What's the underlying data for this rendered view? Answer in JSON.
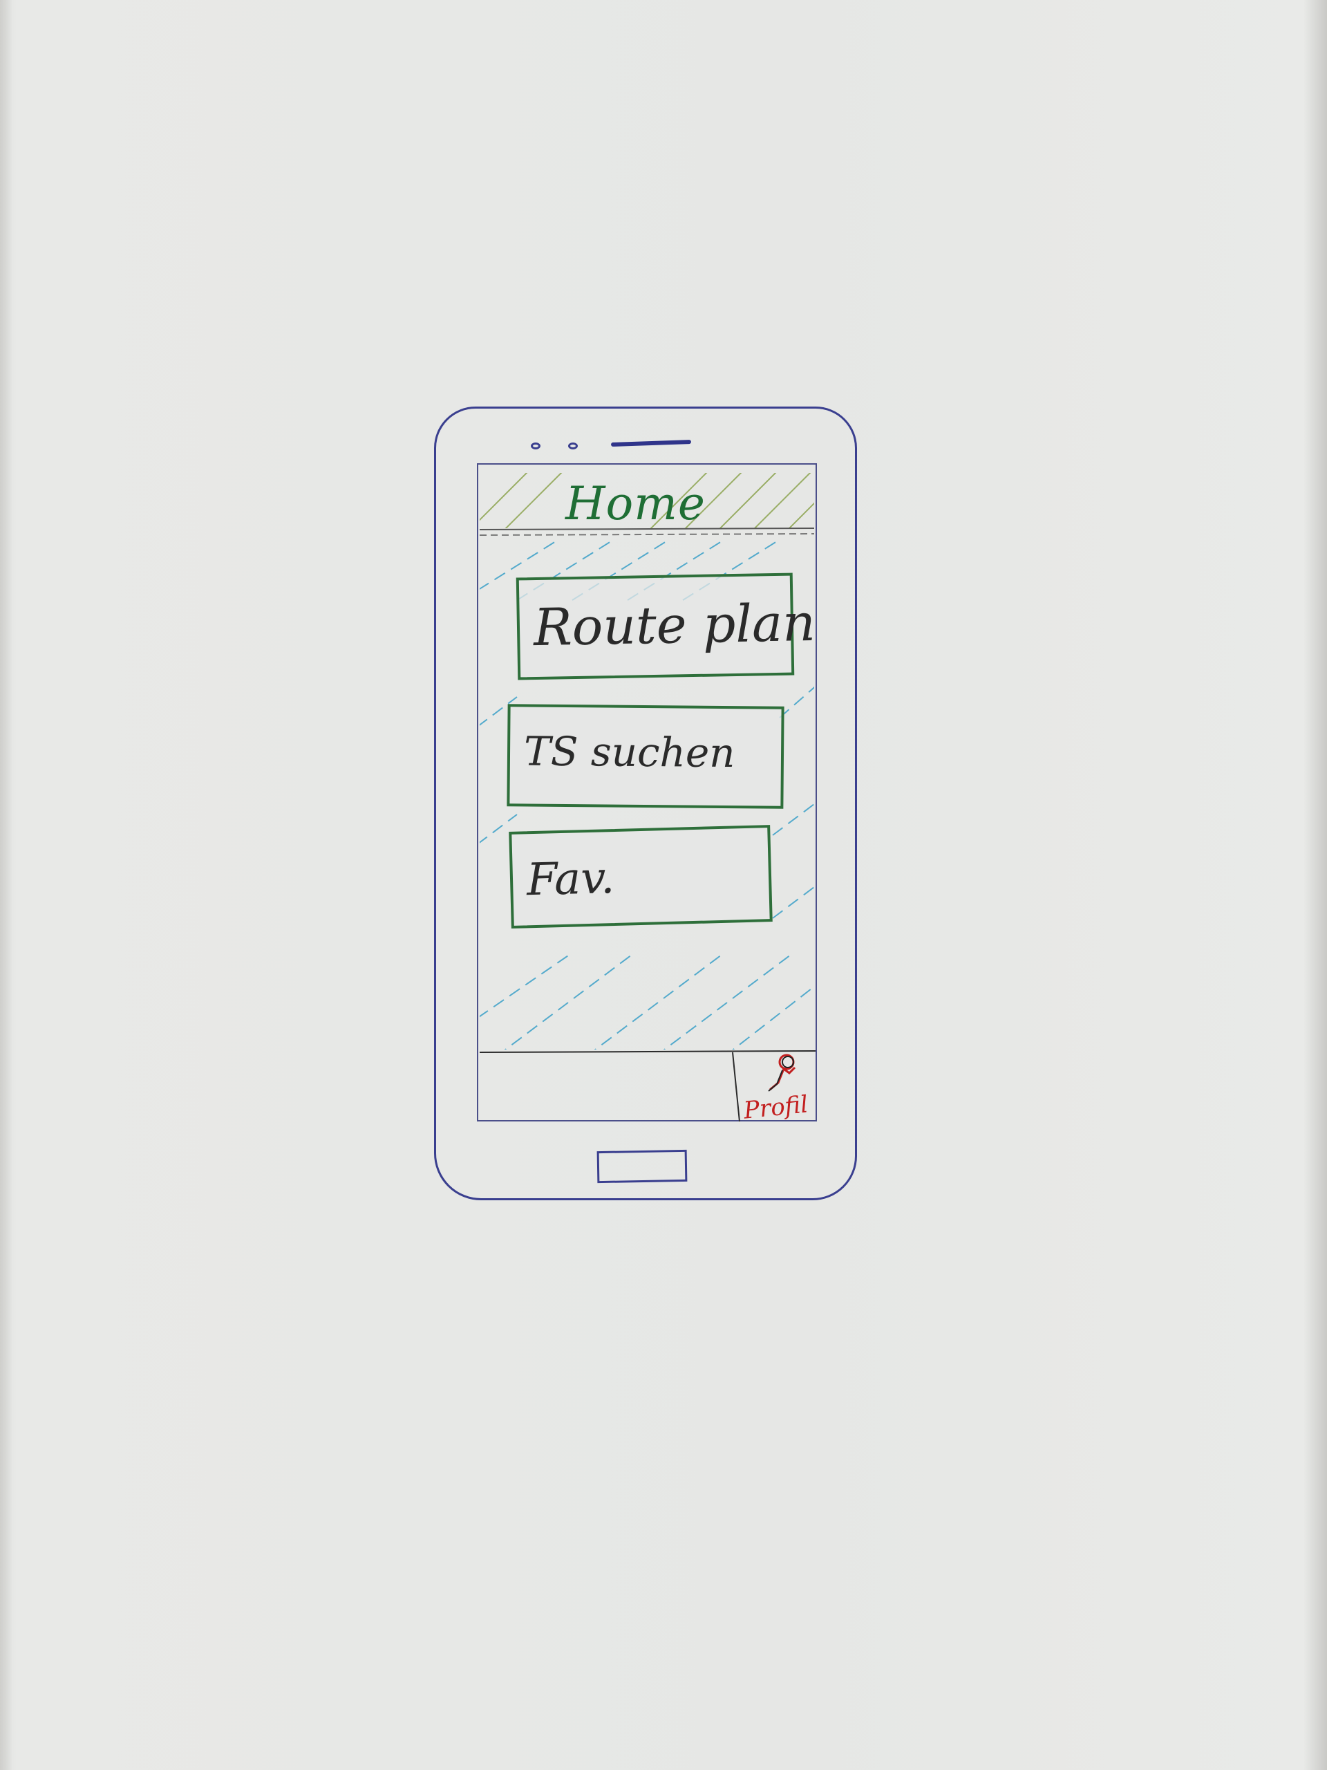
{
  "app": {
    "title": "Home"
  },
  "menu": {
    "items": [
      {
        "label": "Route plan"
      },
      {
        "label": "TS suchen"
      },
      {
        "label": "Fav."
      }
    ]
  },
  "bottom_bar": {
    "profile_label": "Profil",
    "profile_icon": "person-icon"
  },
  "colors": {
    "phone_outline": "#3a3f8f",
    "header_ink": "#1f6e35",
    "button_border": "#2e6f3a",
    "background_hatch": "#3aa0c8",
    "profile_ink": "#c21f1f",
    "paper": "#e6e7e5"
  }
}
